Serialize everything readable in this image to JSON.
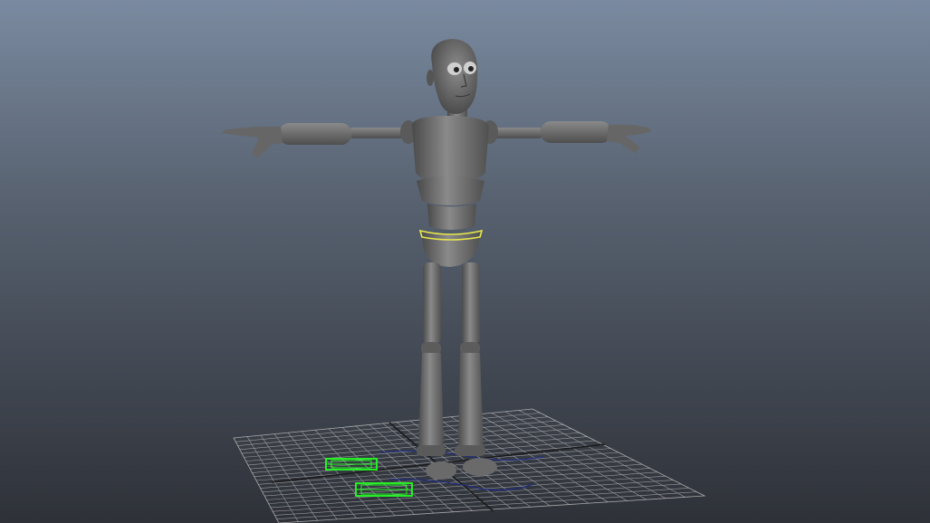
{
  "viewport": {
    "background_top": "#7a8aa0",
    "background_bottom": "#2e3138"
  },
  "scene": {
    "character_pose": "T-pose",
    "character_color": "#6e6e6e",
    "selection_color": "#e8e84a",
    "grid_color": "#c8c8c8",
    "grid_axis_color": "#1a1a1a",
    "controller_color": "#22ff22"
  }
}
